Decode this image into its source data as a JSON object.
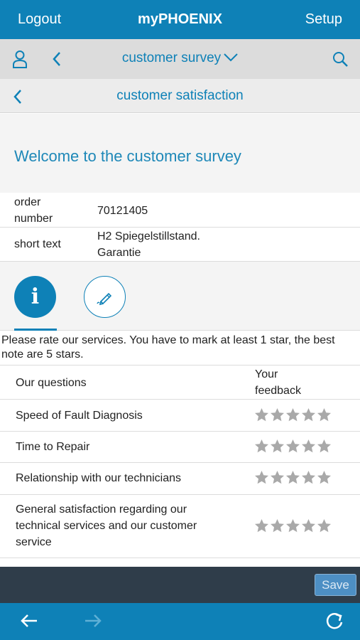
{
  "topbar": {
    "logout_label": "Logout",
    "app_title": "myPHOENIX",
    "setup_label": "Setup"
  },
  "navbar": {
    "title": "customer survey"
  },
  "subnav": {
    "title": "customer satisfaction"
  },
  "welcome": {
    "heading": "Welcome to the customer survey"
  },
  "order": {
    "number_label": "order number",
    "number_value": "70121405",
    "short_text_label": "short text",
    "short_text_value": "H2 Spiegelstillstand. Garantie"
  },
  "instructions": "Please rate our services. You have to mark at least 1 star, the best note are 5 stars.",
  "survey": {
    "header_question": "Our questions",
    "header_feedback": "Your feedback",
    "questions": [
      {
        "text": "Speed of Fault Diagnosis",
        "rating": 0
      },
      {
        "text": "Time to Repair",
        "rating": 0
      },
      {
        "text": "Relationship with our technicians",
        "rating": 0
      },
      {
        "text": "General satisfaction regarding our technical services and our customer service",
        "rating": 0
      }
    ],
    "max_stars": 5
  },
  "save_label": "Save",
  "colors": {
    "primary": "#0e81b7",
    "star_empty": "#a9a9a9",
    "footer": "#2f3d4a"
  },
  "icons": [
    "user-icon",
    "back-arrow-icon",
    "chevron-down-icon",
    "search-icon",
    "info-icon",
    "pencil-icon",
    "star-icon",
    "arrow-left-icon",
    "arrow-right-icon",
    "refresh-icon"
  ]
}
